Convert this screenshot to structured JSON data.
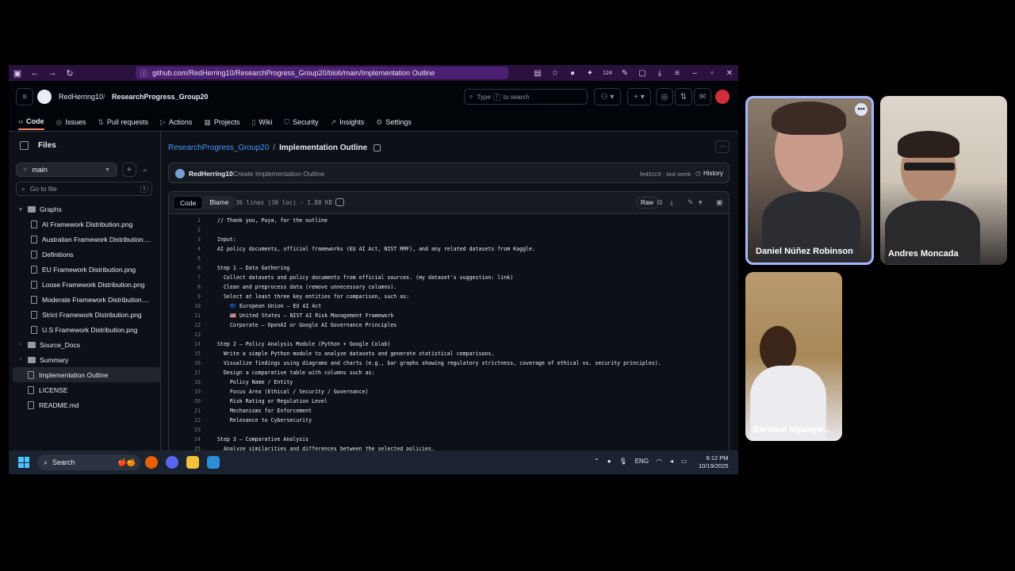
{
  "browser": {
    "url": "github.com/RedHerring10/ResearchProgress_Group20/blob/main/Implementation Outline",
    "badge_count": "124"
  },
  "github": {
    "owner": "RedHerring10",
    "repo": "ResearchProgress_Group20",
    "search_prefix": "Type",
    "search_key": "/",
    "search_suffix": "to search",
    "tabs": [
      "Code",
      "Issues",
      "Pull requests",
      "Actions",
      "Projects",
      "Wiki",
      "Security",
      "Insights",
      "Settings"
    ]
  },
  "sidebar": {
    "title": "Files",
    "branch": "main",
    "goto_placeholder": "Go to file",
    "goto_key": "t",
    "tree": [
      {
        "label": "Graphs",
        "type": "folder",
        "level": 0,
        "expanded": true
      },
      {
        "label": "AI Framework Distribution.png",
        "type": "file",
        "level": 1
      },
      {
        "label": "Australian Framework Distribution....",
        "type": "file",
        "level": 1
      },
      {
        "label": "Definitions",
        "type": "file",
        "level": 1
      },
      {
        "label": "EU Framework Distribution.png",
        "type": "file",
        "level": 1
      },
      {
        "label": "Loose Framework Distribution.png",
        "type": "file",
        "level": 1
      },
      {
        "label": "Moderate Framework Distribution....",
        "type": "file",
        "level": 1
      },
      {
        "label": "Strict Framework Distribution.png",
        "type": "file",
        "level": 1
      },
      {
        "label": "U.S Framework Distribution.png",
        "type": "file",
        "level": 1
      },
      {
        "label": "Source_Docs",
        "type": "folder",
        "level": 0,
        "expanded": false
      },
      {
        "label": "Summary",
        "type": "folder",
        "level": 0,
        "expanded": false
      },
      {
        "label": "Implementation Outline",
        "type": "file",
        "level": 0,
        "selected": true
      },
      {
        "label": "LICENSE",
        "type": "file",
        "level": 0
      },
      {
        "label": "README.md",
        "type": "file",
        "level": 0
      }
    ]
  },
  "main": {
    "crumb_repo": "ResearchProgress_Group20",
    "crumb_sep": "/",
    "crumb_file": "Implementation Outline",
    "commit_author": "RedHerring10",
    "commit_message": "Create Implementation Outline",
    "commit_meta": "fed92c9 · last week",
    "history_label": "History",
    "tab_code": "Code",
    "tab_blame": "Blame",
    "file_info": "36 lines (30 loc) · 1.88 KB",
    "raw_label": "Raw",
    "code_lines": [
      "// Thank you, Puya, for the outline",
      "",
      "Input:",
      "AI policy documents, official frameworks (EU AI Act, NIST RMF), and any related datasets from Kaggle.",
      "",
      "Step 1 – Data Gathering",
      "  Collect datasets and policy documents from official sources. (my dataset's suggestion: link)",
      "  Clean and preprocess data (remove unnecessary columns).",
      "  Select at least three key entities for comparison, such as:",
      "    🇪🇺 European Union – EU AI Act",
      "    🇺🇸 United States – NIST AI Risk Management Framework",
      "    Corporate – OpenAI or Google AI Governance Principles",
      "",
      "Step 2 – Policy Analysis Module (Python + Google Colab)",
      "  Write a simple Python module to analyze datasets and generate statistical comparisons.",
      "  Visualize findings using diagrams and charts (e.g., bar graphs showing regulatory strictness, coverage of ethical vs. security principles).",
      "  Design a comparative table with columns such as:",
      "    Policy Name / Entity",
      "    Focus Area (Ethical / Security / Governance)",
      "    Risk Rating or Regulation Level",
      "    Mechanisms for Enforcement",
      "    Relevance to Cybersecurity",
      "",
      "Step 3 – Comparative Analysis",
      "  Analyze similarities and differences between the selected policies."
    ]
  },
  "taskbar": {
    "search_label": "Search",
    "lang": "ENG",
    "time": "6:12 PM",
    "date": "10/19/2025"
  },
  "participants": [
    {
      "name": "Daniel Núñez Robinson"
    },
    {
      "name": "Andres Moncada"
    },
    {
      "name": "Bernard Ngangsi..."
    }
  ],
  "colors": {
    "accent": "#2f81f7",
    "tab_underline": "#f78166",
    "browser_bar": "#2b1140",
    "active_speaker_border": "#a3b5ff"
  },
  "icons": {
    "back": "arrow-left-icon",
    "reload": "reload-icon",
    "github": "github-logo-icon",
    "menu": "hamburger-icon"
  }
}
